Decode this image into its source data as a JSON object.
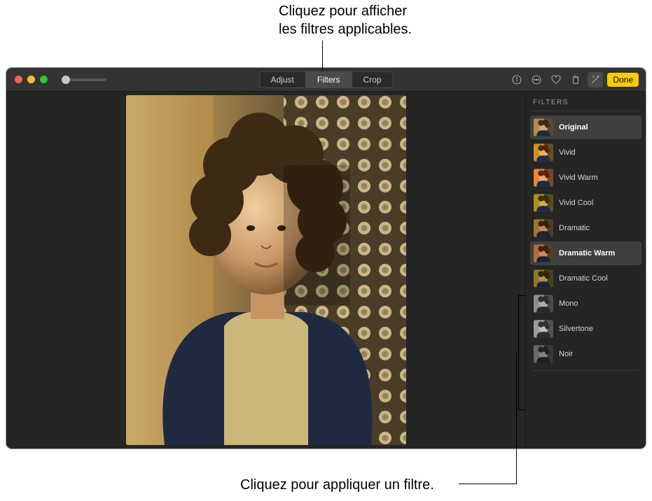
{
  "callouts": {
    "top": "Cliquez pour afficher\nles filtres applicables.",
    "bottom": "Cliquez pour appliquer un filtre."
  },
  "window": {
    "traffic": {
      "close": "close",
      "minimize": "minimize",
      "zoom": "zoom"
    },
    "zoom_slider": {
      "value": 0
    },
    "tabs": {
      "adjust": "Adjust",
      "filters": "Filters",
      "crop": "Crop",
      "active": "filters"
    },
    "icons": {
      "info": "info-icon",
      "more": "more-icon",
      "favorite": "favorite-icon",
      "rotate": "rotate-icon",
      "enhance": "enhance-icon"
    },
    "done": "Done"
  },
  "sidebar": {
    "title": "FILTERS",
    "items": [
      {
        "label": "Original",
        "sat": 1.0,
        "bright": 1.0,
        "hue": 0,
        "gray": 0
      },
      {
        "label": "Vivid",
        "sat": 1.6,
        "bright": 1.05,
        "hue": 0,
        "gray": 0
      },
      {
        "label": "Vivid Warm",
        "sat": 1.6,
        "bright": 1.05,
        "hue": -15,
        "gray": 0
      },
      {
        "label": "Vivid Cool",
        "sat": 1.5,
        "bright": 1.0,
        "hue": 15,
        "gray": 0
      },
      {
        "label": "Dramatic",
        "sat": 1.2,
        "bright": 0.85,
        "hue": 0,
        "gray": 0
      },
      {
        "label": "Dramatic Warm",
        "sat": 1.3,
        "bright": 0.85,
        "hue": -15,
        "gray": 0
      },
      {
        "label": "Dramatic Cool",
        "sat": 1.2,
        "bright": 0.85,
        "hue": 15,
        "gray": 0
      },
      {
        "label": "Mono",
        "sat": 0,
        "bright": 1.0,
        "hue": 0,
        "gray": 1
      },
      {
        "label": "Silvertone",
        "sat": 0,
        "bright": 1.1,
        "hue": 0,
        "gray": 1
      },
      {
        "label": "Noir",
        "sat": 0,
        "bright": 0.75,
        "hue": 0,
        "gray": 1
      }
    ],
    "selected_indices": [
      0,
      5
    ]
  }
}
